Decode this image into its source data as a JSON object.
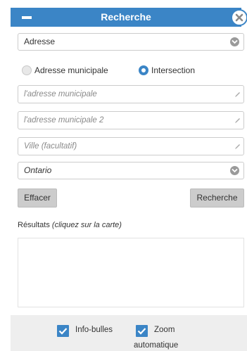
{
  "header": {
    "title": "Recherche",
    "collapse_icon": "minus-icon",
    "close_icon": "close-icon"
  },
  "search_type": {
    "selected": "Adresse",
    "caret_icon": "chevron-down-icon"
  },
  "mode": {
    "options": [
      {
        "label": "Adresse municipale",
        "selected": false
      },
      {
        "label": "Intersection",
        "selected": true
      }
    ]
  },
  "fields": {
    "address1_placeholder": "l'adresse municipale",
    "address2_placeholder": "l'adresse municipale 2",
    "city_placeholder": "Ville (facultatif)",
    "edit_icon": "pencil-icon"
  },
  "province": {
    "selected": "Ontario"
  },
  "actions": {
    "clear_label": "Effacer",
    "search_label": "Recherche"
  },
  "results": {
    "label": "Résultats",
    "hint": "(cliquez sur la carte)"
  },
  "footer": {
    "info_label": "Info-bulles",
    "info_checked": true,
    "zoom_label_line1": "Zoom",
    "zoom_label_line2": "automatique",
    "zoom_checked": true
  },
  "colors": {
    "accent": "#3b85c6",
    "button": "#cccccc",
    "footer_bg": "#eeeeee"
  }
}
